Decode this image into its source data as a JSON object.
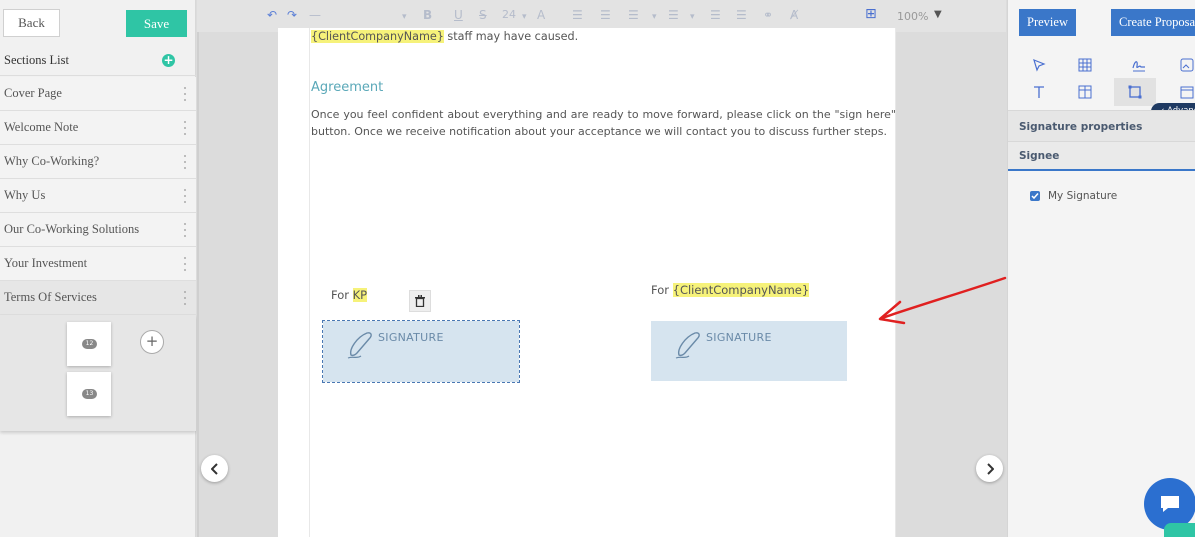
{
  "left_panel": {
    "back_label": "Back",
    "save_label": "Save",
    "sections_title": "Sections List",
    "sections": [
      {
        "label": "Cover Page"
      },
      {
        "label": "Welcome Note"
      },
      {
        "label": "Why Co-Working?"
      },
      {
        "label": "Why Us"
      },
      {
        "label": "Our Co-Working Solutions"
      },
      {
        "label": "Your Investment"
      },
      {
        "label": "Terms Of Services"
      }
    ],
    "pages": [
      "12",
      "13"
    ]
  },
  "toolbar": {
    "font_size": "24",
    "zoom": "100%"
  },
  "document": {
    "top_placeholder": "{ClientCompanyName}",
    "top_text": " staff may have caused.",
    "heading": "Agreement",
    "paragraph": "Once you feel confident about everything and are ready to move forward, please click on the \"sign here\" button. Once we receive notification about your acceptance we will contact you to discuss further steps.",
    "sig_left_prefix": "For ",
    "sig_left_name": "KP",
    "sig_right_prefix": "For ",
    "sig_right_name": "{ClientCompanyName}",
    "signature_label": "SIGNATURE"
  },
  "right_panel": {
    "preview_label": "Preview",
    "create_label": "Create Proposal",
    "advanced_label": "Advanced",
    "properties_title": "Signature properties",
    "signee_title": "Signee",
    "my_signature_label": "My Signature"
  },
  "colors": {
    "accent_green": "#2fc5a5",
    "accent_blue": "#3a77c9",
    "placeholder_highlight": "#f6f27a",
    "signature_fill": "#d6e4ef",
    "annotation_arrow": "#e02020"
  }
}
